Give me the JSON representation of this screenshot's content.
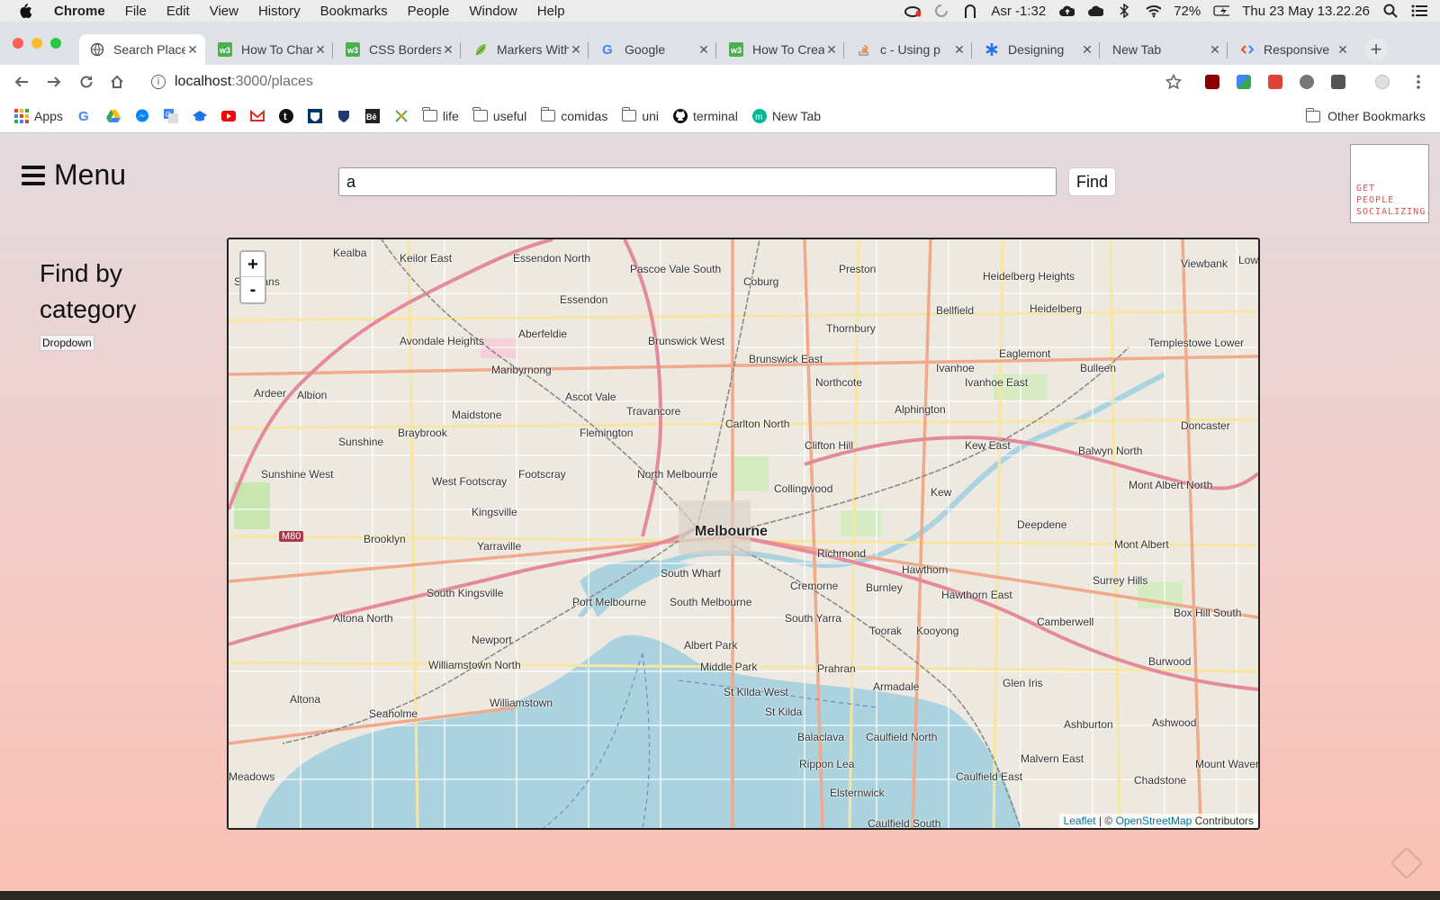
{
  "menubar": {
    "app": "Chrome",
    "items": [
      "File",
      "Edit",
      "View",
      "History",
      "Bookmarks",
      "People",
      "Window",
      "Help"
    ],
    "prayer": "Asr -1:32",
    "battery": "72%",
    "datetime": "Thu 23 May  13.22.26"
  },
  "tabs": [
    {
      "title": "Search Places",
      "active": true
    },
    {
      "title": "How To Change"
    },
    {
      "title": "CSS Borders"
    },
    {
      "title": "Markers With"
    },
    {
      "title": "Google"
    },
    {
      "title": "How To Create"
    },
    {
      "title": "c - Using p"
    },
    {
      "title": "Designing"
    },
    {
      "title": "New Tab"
    },
    {
      "title": "Responsive"
    }
  ],
  "address": {
    "host": "localhost",
    "path": ":3000/places"
  },
  "bookmarks": {
    "apps": "Apps",
    "folders": [
      "life",
      "useful",
      "comidas",
      "uni"
    ],
    "terminal": "terminal",
    "newtab": "New Tab",
    "other": "Other Bookmarks"
  },
  "page": {
    "menu_label": "Menu",
    "search_value": "a",
    "find_label": "Find",
    "logo_lines": [
      "GET",
      "PEOPLE",
      "SOCIALIZING."
    ],
    "category_title": "Find by category",
    "dropdown_label": "Dropdown"
  },
  "map": {
    "zoom_in": "+",
    "zoom_out": "-",
    "attribution_leaflet": "Leaflet",
    "attribution_sep": " | © ",
    "attribution_osm": "OpenStreetMap",
    "attribution_contrib": " Contributors",
    "labels": [
      "Kealba",
      "Keilor East",
      "Essendon North",
      "Pascoe Vale South",
      "Coburg",
      "Preston",
      "Heidelberg Heights",
      "Viewbank",
      "Lower Plenty",
      "St Albans",
      "Essendon",
      "Bellfield",
      "Heidelberg",
      "Avondale Heights",
      "Aberfeldie",
      "Brunswick West",
      "Brunswick East",
      "Thornbury",
      "Templestowe Lower",
      "Maribyrnong",
      "Ivanhoe",
      "Eaglemont",
      "Bulleen",
      "Ardeer",
      "Albion",
      "Ascot Vale",
      "Northcote",
      "Ivanhoe East",
      "Maidstone",
      "Travancore",
      "Alphington",
      "Sunshine",
      "Braybrook",
      "Flemington",
      "Carlton North",
      "Clifton Hill",
      "Kew East",
      "Balwyn North",
      "Doncaster",
      "Sunshine West",
      "North Melbourne",
      "Footscray",
      "West Footscray",
      "Collingwood",
      "Kew",
      "Mont Albert North",
      "Kingsville",
      "Deepdene",
      "Melbourne",
      "Brooklyn",
      "Yarraville",
      "Richmond",
      "Mont Albert",
      "South Wharf",
      "Hawthorn",
      "Surrey Hills",
      "South Kingsville",
      "Port Melbourne",
      "South Melbourne",
      "Cremorne",
      "Burnley",
      "Hawthorn East",
      "Altona North",
      "South Yarra",
      "Camberwell",
      "Box Hill South",
      "Toorak",
      "Kooyong",
      "Newport",
      "Albert Park",
      "Williamstown North",
      "Middle Park",
      "Prahran",
      "Glen Iris",
      "Burwood",
      "Altona",
      "Williamstown",
      "St Kilda West",
      "Armadale",
      "Seaholme",
      "St Kilda",
      "Ashburton",
      "Ashwood",
      "Balaclava",
      "Caulfield North",
      "Malvern East",
      "Rippon Lea",
      "Chadstone",
      "Caulfield East",
      "Mount Waverley",
      "Elsternwick",
      "Caulfield South",
      "M80",
      "Meadows"
    ]
  }
}
